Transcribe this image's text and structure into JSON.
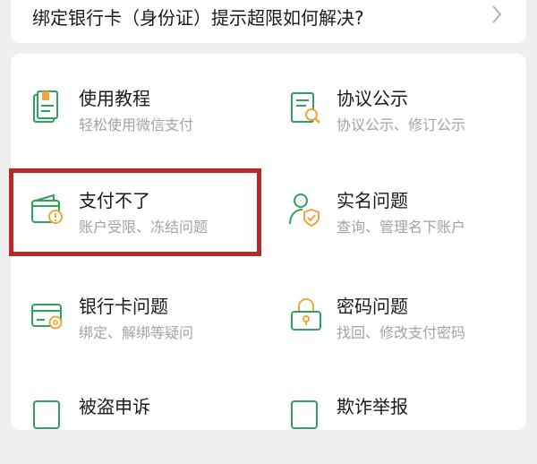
{
  "top_question": {
    "text": "绑定银行卡（身份证）提示超限如何解决?",
    "icon": "chevron-right-icon"
  },
  "colors": {
    "accent_green": "#2aa55a",
    "accent_orange": "#f0a53a",
    "highlight_red": "#b52a27"
  },
  "items": [
    {
      "title": "使用教程",
      "subtitle": "轻松使用微信支付",
      "icon": "tutorial-book-icon"
    },
    {
      "title": "协议公示",
      "subtitle": "协议公示、修订公示",
      "icon": "agreement-document-icon"
    },
    {
      "title": "支付不了",
      "subtitle": "账户受限、冻结问题",
      "icon": "wallet-warning-icon"
    },
    {
      "title": "实名问题",
      "subtitle": "查询、管理名下账户",
      "icon": "user-shield-icon"
    },
    {
      "title": "银行卡问题",
      "subtitle": "绑定、解绑等疑问",
      "icon": "bank-card-gear-icon"
    },
    {
      "title": "密码问题",
      "subtitle": "找回、修改支付密码",
      "icon": "lock-icon"
    },
    {
      "title": "被盗申诉",
      "subtitle": "",
      "icon": "theft-appeal-icon"
    },
    {
      "title": "欺诈举报",
      "subtitle": "",
      "icon": "fraud-report-icon"
    }
  ]
}
